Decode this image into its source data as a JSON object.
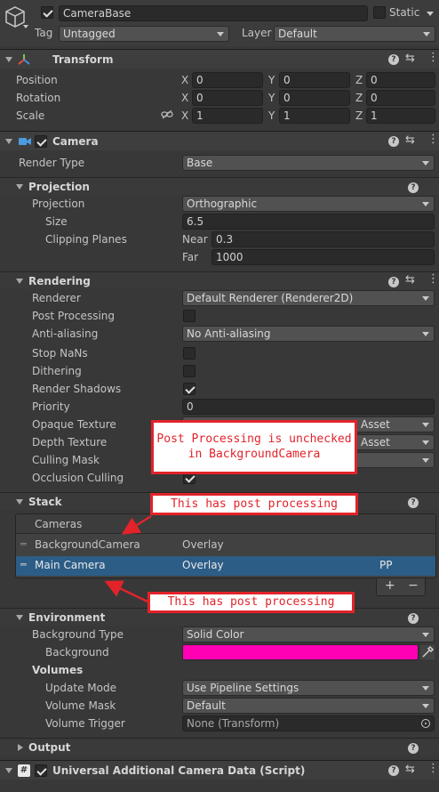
{
  "header": {
    "name": "CameraBase",
    "static_label": "Static",
    "tag_label": "Tag",
    "tag_value": "Untagged",
    "layer_label": "Layer",
    "layer_value": "Default"
  },
  "transform": {
    "title": "Transform",
    "rows": [
      {
        "label": "Position",
        "x": "0",
        "y": "0",
        "z": "0"
      },
      {
        "label": "Rotation",
        "x": "0",
        "y": "0",
        "z": "0"
      },
      {
        "label": "Scale",
        "x": "1",
        "y": "1",
        "z": "1"
      }
    ],
    "axis_x": "X",
    "axis_y": "Y",
    "axis_z": "Z"
  },
  "camera": {
    "title": "Camera",
    "render_type_label": "Render Type",
    "render_type_value": "Base",
    "projection": {
      "title": "Projection",
      "projection_label": "Projection",
      "projection_value": "Orthographic",
      "size_label": "Size",
      "size_value": "6.5",
      "clipping_label": "Clipping Planes",
      "near_label": "Near",
      "near_value": "0.3",
      "far_label": "Far",
      "far_value": "1000"
    },
    "rendering": {
      "title": "Rendering",
      "renderer_label": "Renderer",
      "renderer_value": "Default Renderer (Renderer2D)",
      "post_processing_label": "Post Processing",
      "anti_aliasing_label": "Anti-aliasing",
      "anti_aliasing_value": "No Anti-aliasing",
      "stop_nans_label": "Stop NaNs",
      "dithering_label": "Dithering",
      "render_shadows_label": "Render Shadows",
      "priority_label": "Priority",
      "priority_value": "0",
      "opaque_label": "Opaque Texture",
      "opaque_value": "Asset",
      "depth_label": "Depth Texture",
      "depth_value": "Asset",
      "culling_label": "Culling Mask",
      "occlusion_label": "Occlusion Culling"
    },
    "stack": {
      "title": "Stack",
      "list_header": "Cameras",
      "items": [
        {
          "name": "BackgroundCamera",
          "type": "Overlay",
          "pp": ""
        },
        {
          "name": "Main Camera",
          "type": "Overlay",
          "pp": "PP"
        }
      ],
      "add": "+",
      "remove": "−"
    },
    "environment": {
      "title": "Environment",
      "bg_type_label": "Background Type",
      "bg_type_value": "Solid Color",
      "background_label": "Background",
      "background_color": "#ff00b4",
      "volumes_label": "Volumes",
      "update_mode_label": "Update Mode",
      "update_mode_value": "Use Pipeline Settings",
      "volume_mask_label": "Volume Mask",
      "volume_mask_value": "Default",
      "volume_trigger_label": "Volume Trigger",
      "volume_trigger_value": "None (Transform)"
    },
    "output": {
      "title": "Output"
    }
  },
  "additional": {
    "title": "Universal Additional Camera Data (Script)"
  },
  "annotations": {
    "box1": "Post Processing is unchecked\nin BackgroundCamera",
    "box2": "This has post processing",
    "box3": "This has post processing"
  },
  "colors": {
    "accent_selected": "#2c5d87",
    "annotation": "#e2232a"
  }
}
